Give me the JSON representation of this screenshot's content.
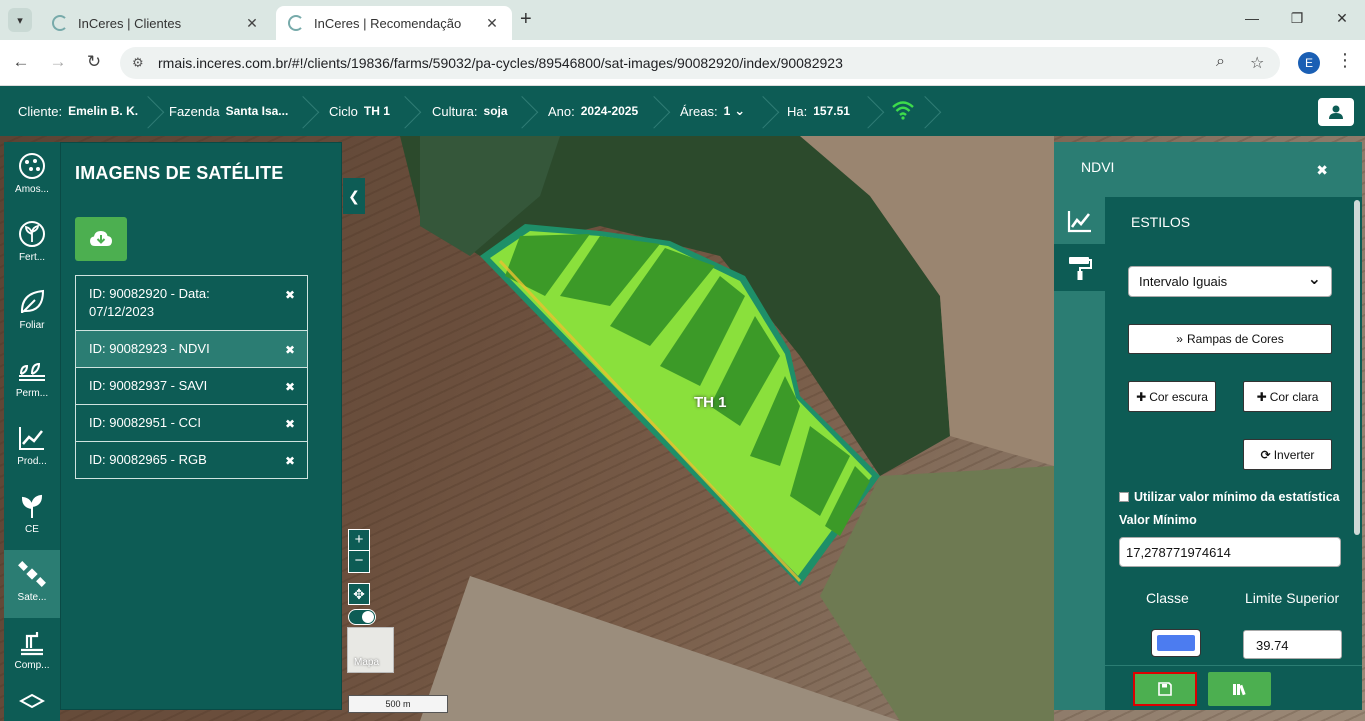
{
  "browser": {
    "tabs": [
      {
        "title": "InCeres | Clientes",
        "active": false
      },
      {
        "title": "InCeres | Recomendação",
        "active": true
      }
    ],
    "url": "rmais.inceres.com.br/#!/clients/19836/farms/59032/pa-cycles/89546800/sat-images/90082920/index/90082923",
    "profile_initial": "E"
  },
  "header": {
    "cliente_label": "Cliente:",
    "cliente_value": "Emelin B. K.",
    "fazenda_label": "Fazenda",
    "fazenda_value": "Santa Isa...",
    "ciclo_label": "Ciclo",
    "ciclo_value": "TH 1",
    "cultura_label": "Cultura:",
    "cultura_value": "soja",
    "ano_label": "Ano:",
    "ano_value": "2024-2025",
    "areas_label": "Áreas:",
    "areas_value": "1",
    "ha_label": "Ha:",
    "ha_value": "157.51",
    "wifi_color": "#3ddc4b"
  },
  "toolstrip": [
    {
      "label": "Amos...",
      "icon": "sampling-icon"
    },
    {
      "label": "Fert...",
      "icon": "fertilizer-icon"
    },
    {
      "label": "Foliar",
      "icon": "leaf-icon"
    },
    {
      "label": "Perm...",
      "icon": "plants-icon"
    },
    {
      "label": "Prod...",
      "icon": "productivity-chart-icon"
    },
    {
      "label": "CE",
      "icon": "sprout-icon"
    },
    {
      "label": "Sate...",
      "icon": "satellite-icon",
      "active": true
    },
    {
      "label": "Comp...",
      "icon": "compaction-icon"
    }
  ],
  "satpanel": {
    "title": "IMAGENS DE SATÉLITE",
    "images": [
      {
        "text": "ID: 90082920 - Data: 07/12/2023"
      },
      {
        "text": "ID: 90082923 - NDVI",
        "active": true
      },
      {
        "text": "ID: 90082937 - SAVI"
      },
      {
        "text": "ID: 90082951 - CCI"
      },
      {
        "text": "ID: 90082965 - RGB"
      }
    ]
  },
  "map": {
    "field_label": "TH 1",
    "zoom_in": "+",
    "zoom_out": "−",
    "basemap_label": "Mapa",
    "scale_label": "500 m"
  },
  "ndvi": {
    "title": "NDVI",
    "section": "ESTILOS",
    "method_value": "Intervalo Iguais",
    "ramps_label": "Rampas de Cores",
    "dark_color_label": "Cor escura",
    "light_color_label": "Cor clara",
    "invert_label": "Inverter",
    "use_min_label": "Utilizar valor mínimo da estatística",
    "min_label": "Valor Mínimo",
    "min_value": "17,278771974614",
    "class_header": "Classe",
    "upper_limit_header": "Limite Superior",
    "first_class_color": "#4c7cf0",
    "first_upper_limit": "39.74"
  },
  "colors": {
    "primary": "#0d5c55",
    "secondary": "#2b7d73",
    "accent_green": "#4caf50",
    "highlight_red": "#dd0000"
  }
}
